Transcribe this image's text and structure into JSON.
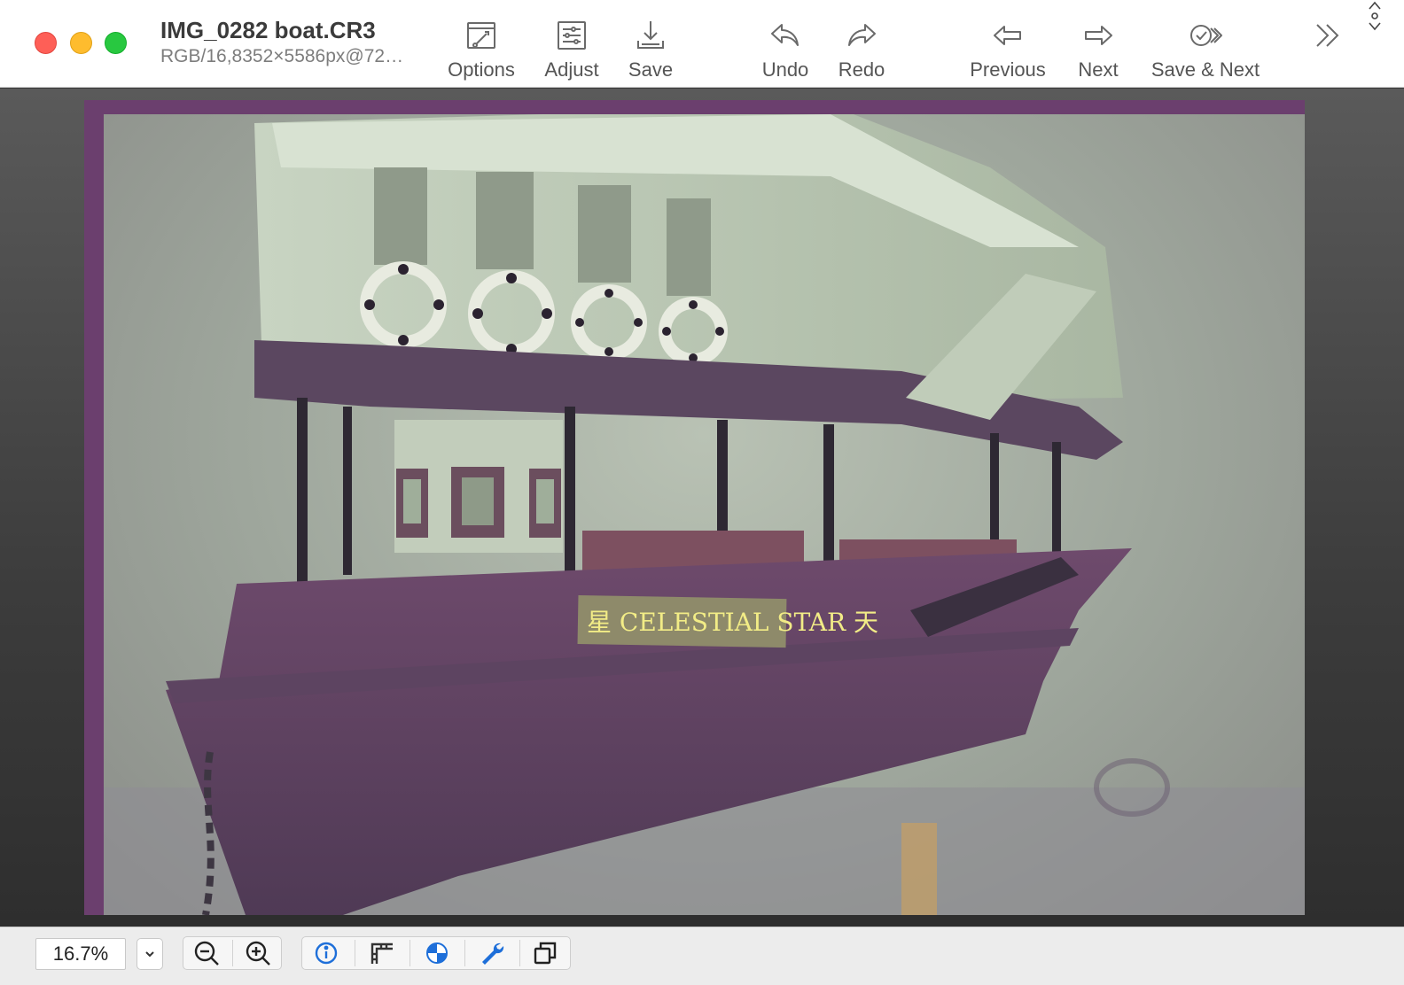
{
  "window": {
    "title": "IMG_0282 boat.CR3",
    "subtitle": "RGB/16,8352×5586px@72…"
  },
  "toolbar": {
    "options_label": "Options",
    "adjust_label": "Adjust",
    "save_label": "Save",
    "undo_label": "Undo",
    "redo_label": "Redo",
    "previous_label": "Previous",
    "next_label": "Next",
    "save_next_label": "Save & Next",
    "overflow_icon": "chevron-double-right-icon"
  },
  "photo": {
    "nameplate_text": "星 CELESTIAL STAR 天"
  },
  "statusbar": {
    "zoom_value": "16.7%",
    "tools": [
      "zoom-out-icon",
      "zoom-in-icon",
      "info-icon",
      "crop-icon",
      "color-icon",
      "wrench-icon",
      "duplicate-icon"
    ]
  },
  "colors": {
    "close": "#fe5f57",
    "minimize": "#febc2e",
    "zoom": "#28c840",
    "accent_blue": "#1e6fd9",
    "frame_purple": "#6b3f6e"
  }
}
